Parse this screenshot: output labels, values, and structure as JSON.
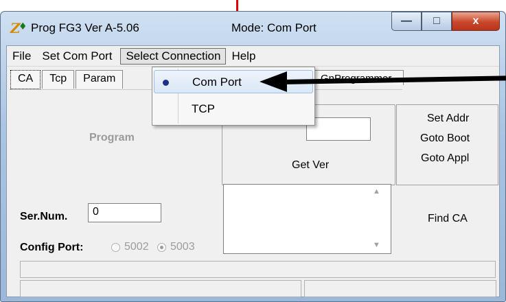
{
  "window": {
    "title": "Prog FG3  Ver A-5.06",
    "mode": "Mode: Com Port",
    "icon": "app-logo-icon",
    "controls": {
      "minimize": "—",
      "maximize": "□",
      "close": "x"
    }
  },
  "menubar": {
    "items": [
      "File",
      "Set Com Port",
      "Select Connection",
      "Help"
    ]
  },
  "dropdown": {
    "items": [
      {
        "label": "Com Port",
        "selected": true
      },
      {
        "label": "TCP",
        "selected": false
      }
    ]
  },
  "tabs": {
    "items": [
      "CA",
      "Tcp",
      "Param"
    ],
    "partial": "GnProgrammer"
  },
  "left_panel": {
    "program": "Program",
    "sernum_label": "Ser.Num.",
    "sernum_value": "0",
    "config_label": "Config Port:",
    "port_options": [
      "5002",
      "5003"
    ],
    "port_selected": "5003"
  },
  "middle_panel": {
    "get_ver": "Get Ver"
  },
  "right_panel": {
    "set_addr": "Set Addr",
    "goto_boot": "Goto Boot",
    "goto_appl": "Goto Appl",
    "find_ca": "Find CA"
  },
  "annotations": {
    "red_arrow_color": "#e00000",
    "black_arrow_color": "#000000"
  }
}
